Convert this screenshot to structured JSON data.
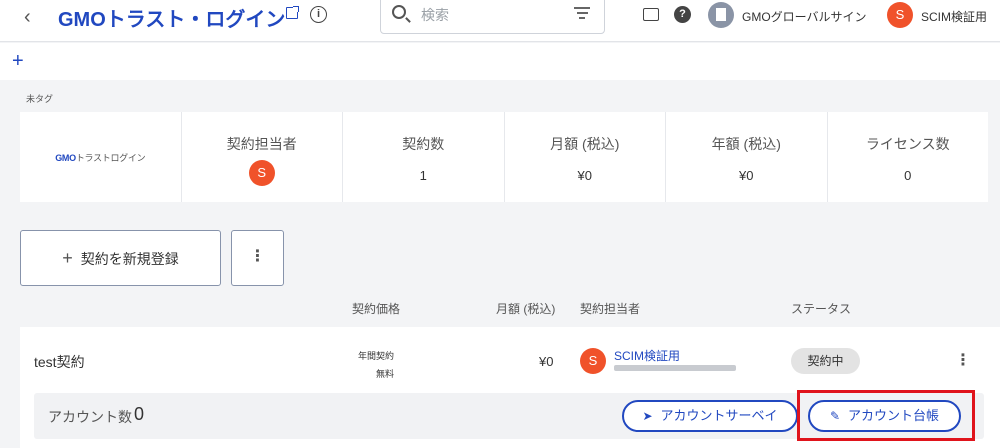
{
  "header": {
    "back_icon": "chevron-left-icon",
    "title": "GMOトラスト・ログイン",
    "search_placeholder": "検索",
    "org_name": "GMOグローバルサイン",
    "user_initial": "S",
    "user_name": "SCIM検証用"
  },
  "tag_label": "未タグ",
  "app_logo": {
    "brand": "GMO",
    "rest": "トラストログイン"
  },
  "stats": {
    "owner_label": "契約担当者",
    "owner_initial": "S",
    "contracts_label": "契約数",
    "contracts_value": "1",
    "monthly_label": "月額 (税込)",
    "monthly_value": "¥0",
    "yearly_label": "年額 (税込)",
    "yearly_value": "¥0",
    "licenses_label": "ライセンス数",
    "licenses_value": "0"
  },
  "actions": {
    "new_contract": "契約を新規登録",
    "more": "⋮"
  },
  "table": {
    "headers": {
      "price": "契約価格",
      "monthly": "月額 (税込)",
      "owner": "契約担当者",
      "status": "ステータス"
    },
    "row": {
      "name": "test契約",
      "contract_type": "年間契約",
      "price": "無料",
      "monthly": "¥0",
      "owner_initial": "S",
      "owner_name": "SCIM検証用",
      "status": "契約中"
    },
    "sub": {
      "account_label": "アカウント数",
      "account_count": "0",
      "survey_button": "アカウントサーベイ",
      "ledger_button": "アカウント台帳"
    }
  },
  "colors": {
    "accent": "#2148c0",
    "avatar": "#f0522a",
    "highlight": "#e0141c"
  }
}
